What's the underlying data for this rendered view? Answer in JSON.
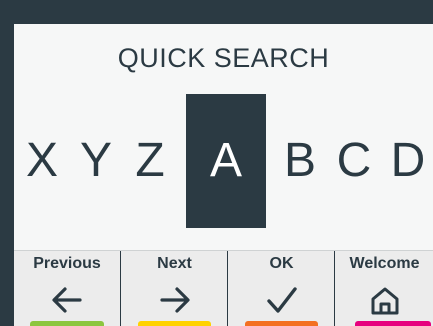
{
  "screen": {
    "title": "QUICK SEARCH"
  },
  "alphabet": {
    "letters_before": [
      "X",
      "Y",
      "Z"
    ],
    "selected": "A",
    "letters_after": [
      "B",
      "C",
      "D"
    ]
  },
  "softkeys": [
    {
      "label": "Previous",
      "icon": "arrow-left-icon",
      "color": "#8cc63f"
    },
    {
      "label": "Next",
      "icon": "arrow-right-icon",
      "color": "#ffd200"
    },
    {
      "label": "OK",
      "icon": "checkmark-icon",
      "color": "#f37021"
    },
    {
      "label": "Welcome",
      "icon": "home-icon",
      "color": "#e6007e"
    }
  ],
  "colors": {
    "dark": "#2b3a43",
    "screen_bg": "#f6f7f7"
  }
}
